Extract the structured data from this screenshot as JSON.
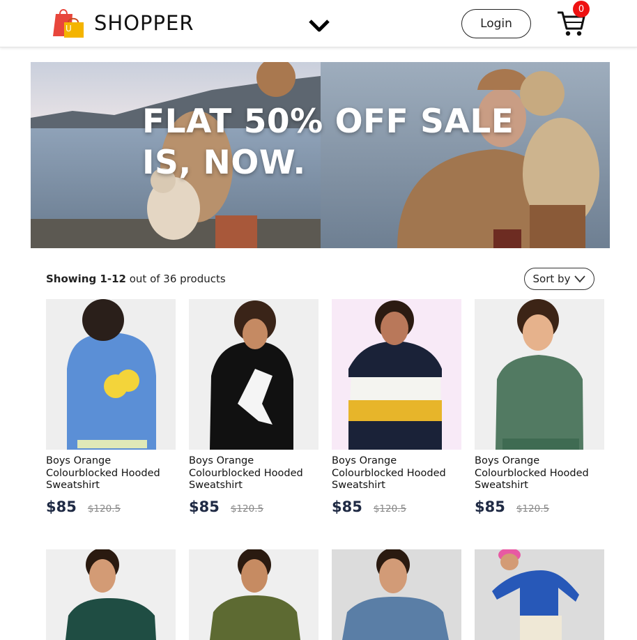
{
  "header": {
    "brand": "SHOPPER",
    "login_label": "Login",
    "cart_count": "0"
  },
  "hero": {
    "headline_line1": "FLAT 50% OFF SALE",
    "headline_line2": "IS, NOW."
  },
  "listing": {
    "showing_bold": "Showing 1-12",
    "showing_rest": " out of 36 products",
    "sort_label": "Sort by"
  },
  "products": [
    {
      "title": "Boys Orange Colourblocked Hooded Sweatshirt",
      "price": "$85",
      "old_price": "$120.5"
    },
    {
      "title": "Boys Orange Colourblocked Hooded Sweatshirt",
      "price": "$85",
      "old_price": "$120.5"
    },
    {
      "title": "Boys Orange Colourblocked Hooded Sweatshirt",
      "price": "$85",
      "old_price": "$120.5"
    },
    {
      "title": "Boys Orange Colourblocked Hooded Sweatshirt",
      "price": "$85",
      "old_price": "$120.5"
    }
  ],
  "colors": {
    "price": "#1f2a44",
    "badge": "#ee1111",
    "logo_bag_red": "#e8463c",
    "logo_bag_yellow": "#f4b400"
  },
  "icons": [
    "shopping-bag-logo-icon",
    "chevron-down-icon",
    "cart-icon",
    "sort-chevron-icon"
  ]
}
